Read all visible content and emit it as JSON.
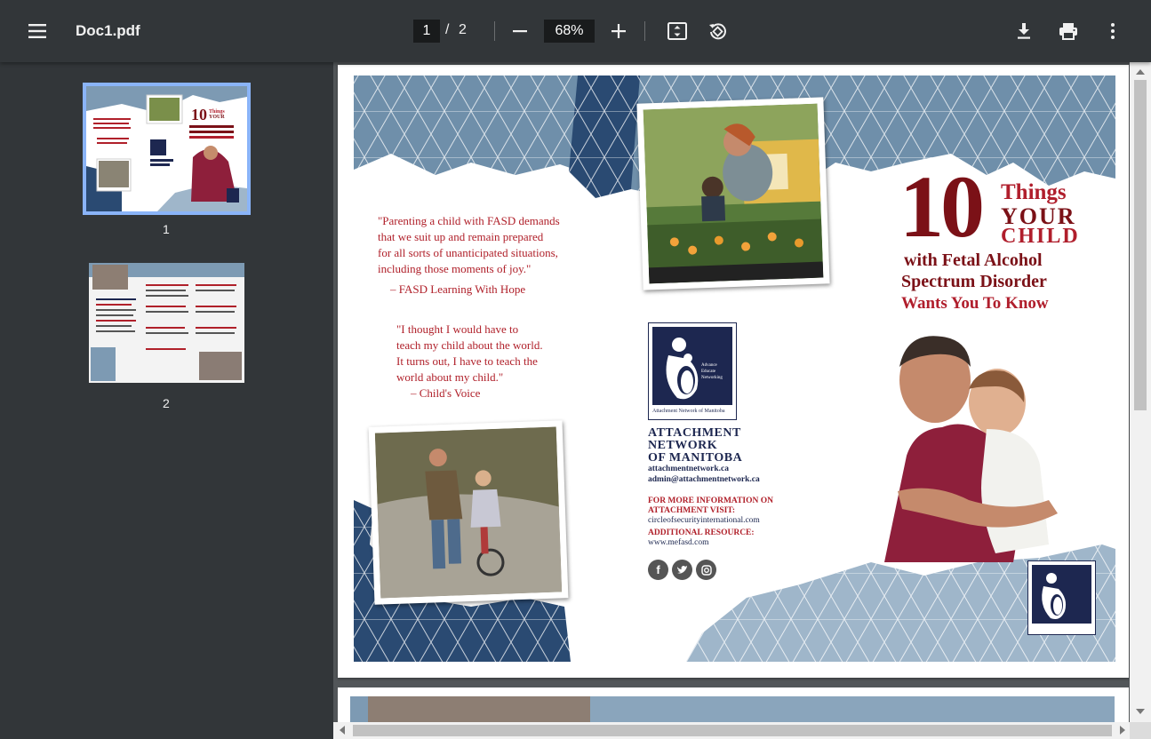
{
  "toolbar": {
    "file_name": "Doc1.pdf",
    "current_page": "1",
    "separator": "/",
    "total_pages": "2",
    "zoom": "68%"
  },
  "sidebar": {
    "thumbnails": [
      {
        "label": "1",
        "selected": true
      },
      {
        "label": "2",
        "selected": false
      }
    ]
  },
  "page1": {
    "quote1": "\"Parenting a child with FASD demands\n that we suit up and remain prepared\n for all sorts of unanticipated situations,\n including those moments of joy.\"",
    "quote1_attr": "– FASD Learning With Hope",
    "quote2": "\"I thought I would have to\n teach my child about the world.\n It turns out, I have to teach the\n world about my child.\"",
    "quote2_attr": "– Child's Voice",
    "title_number": "10",
    "title_things": "Things",
    "title_your": "YOUR",
    "title_child": "CHILD",
    "subtitle_line1": "with Fetal Alcohol",
    "subtitle_line2": "Spectrum Disorder",
    "subtitle_line3": "Wants You To Know",
    "logo_caption": "Attachment Network of Manitoba",
    "logo_text": "Advance Educate Networking",
    "org_line1": "ATTACHMENT",
    "org_line2": "NETWORK",
    "org_line3": "OF MANITOBA",
    "website": "attachmentnetwork.ca",
    "email": "admin@attachmentnetwork.ca",
    "more_info_line1": "FOR MORE INFORMATION ON",
    "more_info_line2": "ATTACHMENT VISIT:",
    "more_info_url": "circleofsecurityinternational.com",
    "additional_label": "ADDITIONAL RESOURCE:",
    "additional_url": "www.mefasd.com"
  },
  "colors": {
    "toolbar_bg": "#323639",
    "viewer_bg": "#525659",
    "brand_red": "#b01e2c",
    "brand_maroon": "#7b1117",
    "brand_navy": "#1d2750",
    "geo_blue": "#6f8faa"
  }
}
